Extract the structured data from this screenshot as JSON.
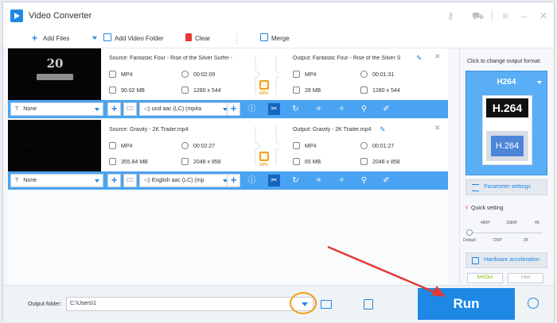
{
  "window": {
    "title": "Video Converter"
  },
  "toolbar": {
    "add_files": "Add Files",
    "add_video_folder": "Add Video Folder",
    "clear": "Clear",
    "merge": "Merge"
  },
  "items": [
    {
      "source": "Source: Fantastic Four - Rise of the Silver Surfer -",
      "src_format": "MP4",
      "src_duration": "00:02:09",
      "src_size": "90.02 MB",
      "src_resolution": "1280 x 544",
      "output": "Output: Fantastic Four - Rise of the Silver S",
      "out_format": "MP4",
      "out_duration": "00:01:31",
      "out_size": "28 MB",
      "out_resolution": "1280 x 544",
      "subtitle": "None",
      "audio": "und aac (LC) (mp4a",
      "thumb_text": "20"
    },
    {
      "source": "Source: Gravity - 2K Trailer.mp4",
      "src_format": "MP4",
      "src_duration": "00:02:27",
      "src_size": "355.84 MB",
      "src_resolution": "2048 x 858",
      "output": "Output: Gravity - 2K Trailer.mp4",
      "out_format": "MP4",
      "out_duration": "00:01:27",
      "out_size": "65 MB",
      "out_resolution": "2048 x 858",
      "subtitle": "None",
      "audio": "English aac (LC) (mp",
      "thumb_text": "..."
    }
  ],
  "gpu_label": "GPU",
  "cc_label": "CC",
  "right_panel": {
    "hint": "Click to change output format:",
    "format": "H264",
    "icon_top": "H.264",
    "icon_bottom": "H.264",
    "parameter_settings": "Parameter settings",
    "quick_setting": "Quick setting",
    "scale_top": [
      "480P",
      "1080P",
      "4K"
    ],
    "scale_bottom": [
      "Default",
      "720P",
      "2K"
    ],
    "hardware_acceleration": "Hardware acceleration",
    "brands": [
      "NVIDIA",
      "Intel"
    ]
  },
  "bottom": {
    "output_folder_label": "Output folder:",
    "output_folder_value": "C:\\Users\\1",
    "run": "Run"
  },
  "colors": {
    "accent": "#1e88e5",
    "highlight": "#f39c12",
    "annotation": "#e53935"
  }
}
